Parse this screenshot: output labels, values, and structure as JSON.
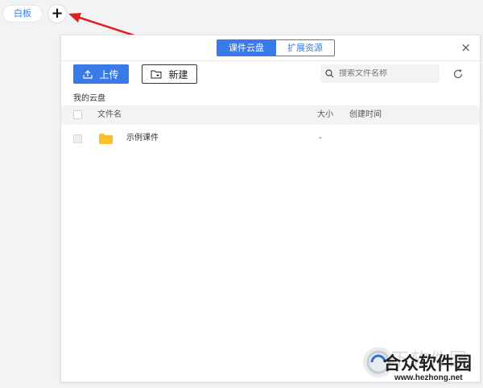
{
  "top_tabs": {
    "whiteboard_label": "白板",
    "add_label": "+"
  },
  "panel": {
    "segments": {
      "active_label": "课件云盘",
      "inactive_label": "扩展资源"
    },
    "close_label": "×",
    "toolbar": {
      "upload_label": "上传",
      "new_label": "新建",
      "search_placeholder": "搜索文件名称"
    },
    "breadcrumb": "我的云盘",
    "table": {
      "headers": {
        "name": "文件名",
        "size": "大小",
        "created": "创建时间"
      },
      "rows": [
        {
          "name": "示例课件",
          "size": "-",
          "created": ""
        }
      ]
    }
  },
  "watermark": {
    "text_bg": "当下软件园",
    "text": "合众软件园",
    "url": "www.hezhong.net"
  },
  "colors": {
    "accent": "#3a7ae8",
    "arrow": "#e02020",
    "folder": "#f7c130"
  }
}
